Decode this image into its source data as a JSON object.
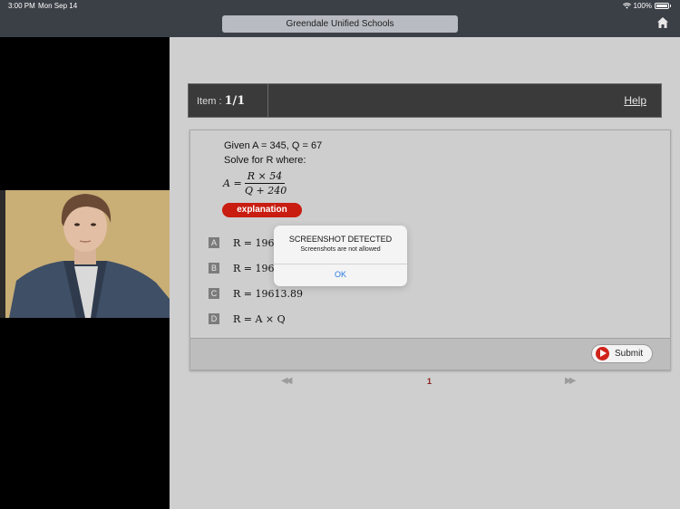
{
  "status_bar": {
    "time": "3:00 PM",
    "date": "Mon Sep 14",
    "battery": "100%"
  },
  "nav": {
    "title": "Greendale Unified Schools",
    "home_icon": "home-icon"
  },
  "item": {
    "label": "Item :",
    "number": "1/1",
    "help": "Help"
  },
  "question": {
    "given": "Given A = 345, Q = 67",
    "prompt": "Solve for R where:",
    "formula_lhs": "A =",
    "formula_num": "R × 54",
    "formula_den": "Q + 240",
    "explanation_label": "explanation"
  },
  "choices": [
    {
      "letter": "A",
      "text": "R = 1961"
    },
    {
      "letter": "B",
      "text": "R = 196.1"
    },
    {
      "letter": "C",
      "text": "R = 19613.89"
    },
    {
      "letter": "D",
      "text": "R = A × Q"
    }
  ],
  "submit": {
    "label": "Submit"
  },
  "pager": {
    "prev": "◀◀",
    "page": "1",
    "next": "▶▶"
  },
  "alert": {
    "title": "SCREENSHOT DETECTED",
    "message": "Screenshots are not allowed",
    "ok": "OK"
  },
  "colors": {
    "accent_red": "#c81d10",
    "ios_blue": "#2a7ae2",
    "topbar": "#3b3f46"
  }
}
